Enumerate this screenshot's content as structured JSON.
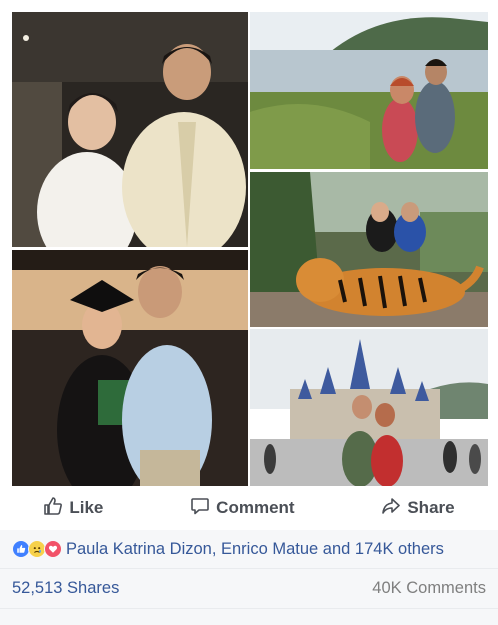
{
  "post": {
    "actions": {
      "like_label": "Like",
      "comment_label": "Comment",
      "share_label": "Share"
    },
    "reactions": {
      "icons": [
        "like-icon",
        "sad-icon",
        "love-icon"
      ],
      "summary": "Paula Katrina Dizon, Enrico Matue and 174K others"
    },
    "stats": {
      "shares": "52,513 Shares",
      "comments": "40K Comments"
    },
    "colors": {
      "link": "#365899",
      "action_text": "#4b4f56",
      "like_blue": "#4080ff",
      "love_red": "#f25268",
      "sad_yellow": "#f7d14a",
      "stats_background": "#f6f7f9"
    }
  }
}
